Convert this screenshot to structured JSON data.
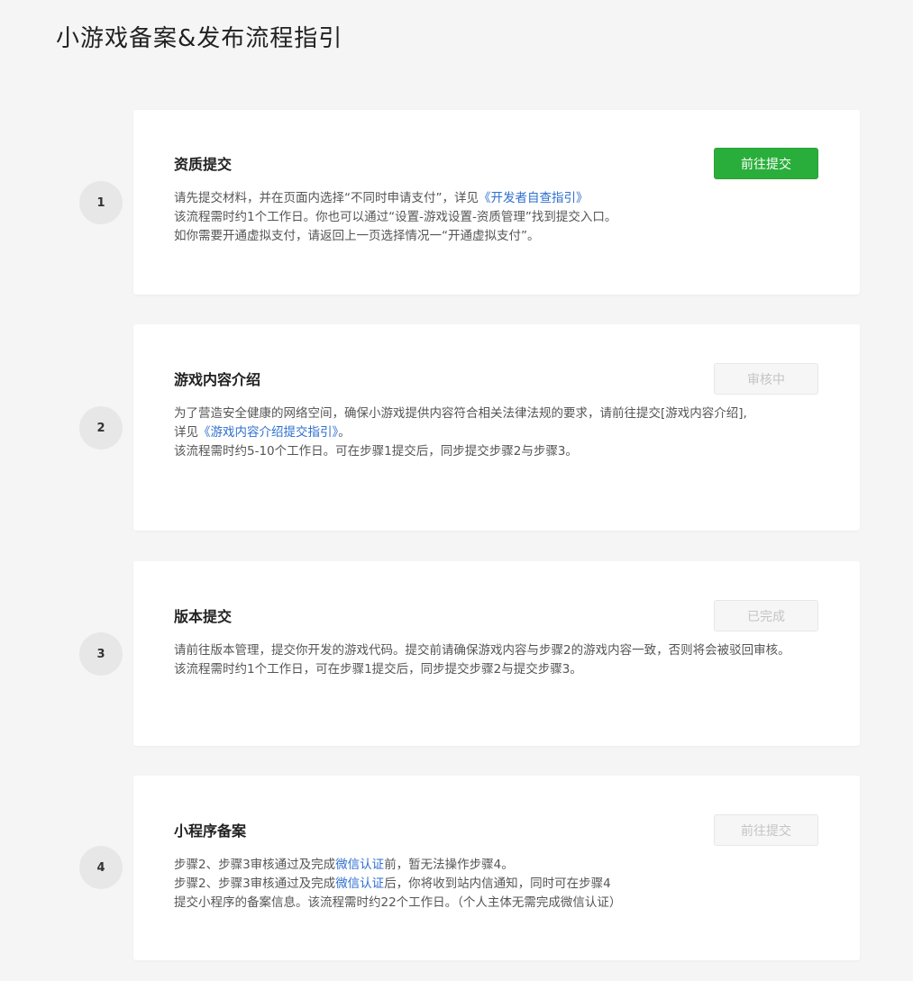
{
  "page": {
    "title": "小游戏备案&发布流程指引"
  },
  "steps": [
    {
      "number": "1",
      "title": "资质提交",
      "button": {
        "label": "前往提交",
        "state": "primary",
        "color": "#2aae3b"
      },
      "lines": [
        {
          "before": "请先提交材料，并在页面内选择“不同时申请支付”，详见",
          "link": "《开发者自查指引》",
          "after": ""
        },
        {
          "text": "该流程需时约1个工作日。你也可以通过“设置-游戏设置-资质管理”找到提交入口。"
        },
        {
          "text": "如你需要开通虚拟支付，请返回上一页选择情况一“开通虚拟支付”。"
        }
      ]
    },
    {
      "number": "2",
      "title": "游戏内容介绍",
      "button": {
        "label": "审核中",
        "state": "disabled"
      },
      "lines": [
        {
          "text": "为了营造安全健康的网络空间，确保小游戏提供内容符合相关法律法规的要求，请前往提交[游戏内容介绍],"
        },
        {
          "before": "详见",
          "link": "《游戏内容介绍提交指引》",
          "after": "。"
        },
        {
          "text": "该流程需时约5-10个工作日。可在步骤1提交后，同步提交步骤2与步骤3。"
        }
      ]
    },
    {
      "number": "3",
      "title": "版本提交",
      "button": {
        "label": "已完成",
        "state": "disabled"
      },
      "lines": [
        {
          "text": "请前往版本管理，提交你开发的游戏代码。提交前请确保游戏内容与步骤2的游戏内容一致，否则将会被驳回审核。"
        },
        {
          "text": "该流程需时约1个工作日，可在步骤1提交后，同步提交步骤2与提交步骤3。"
        }
      ]
    },
    {
      "number": "4",
      "title": "小程序备案",
      "button": {
        "label": "前往提交",
        "state": "disabled"
      },
      "lines": [
        {
          "before": "步骤2、步骤3审核通过及完成",
          "link": "微信认证",
          "after": "前，暂无法操作步骤4。"
        },
        {
          "before": "步骤2、步骤3审核通过及完成",
          "link": "微信认证",
          "after": "后，你将收到站内信通知，同时可在步骤4"
        },
        {
          "text": "提交小程序的备案信息。该流程需时约22个工作日。（个人主体无需完成微信认证）"
        }
      ]
    }
  ],
  "colors": {
    "link": "#2e6fcf",
    "primary": "#2aae3b",
    "background": "#f5f5f5"
  }
}
